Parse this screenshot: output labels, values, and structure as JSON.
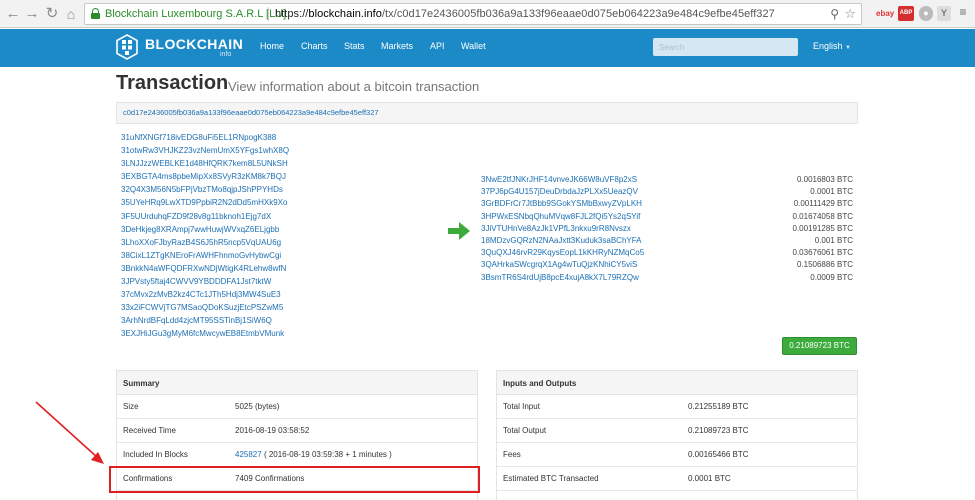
{
  "browser": {
    "site_identity": "Blockchain Luxembourg S.A.R.L [LU]",
    "url_prefix": "https://",
    "url_host": "blockchain.info",
    "url_path": "/tx/c0d17e2436005fb036a9a133f96eaae0d075eb064223a9e484c9efbe45eff327",
    "extensions": [
      "ebay",
      "ABP",
      "Y"
    ]
  },
  "navbar": {
    "logo_text": "BLOCKCHAIN",
    "logo_sub": "info",
    "items": [
      "Home",
      "Charts",
      "Stats",
      "Markets",
      "API",
      "Wallet"
    ],
    "search_placeholder": "Search",
    "language": "English"
  },
  "page": {
    "title": "Transaction",
    "subtitle": "View information about a bitcoin transaction",
    "tx_hash": "c0d17e2436005fb036a9a133f96eaae0d075eb064223a9e484c9efbe45eff327"
  },
  "inputs": [
    "31uNfXNGf718ivEDG8uFi5EL1RNpogK388",
    "31otwRw3VHJKZ23vzNemUmX5YFgs1whX8Q",
    "3LNJJzzWEBLKE1d48HfQRK7kem8L5UNkSH",
    "3EXBGTA4ms8pbeMipXx8SVyR3zKM8k7BQJ",
    "32Q4X3M56N5bFPjVbzTMo8qjpJShPPYHDs",
    "35UYeHRq9LwXTD9PpbiR2N2dDd5mHXk9Xo",
    "3F5UUrduhqFZD9f28v8g11bknoh1Ejg7dX",
    "3DeHkjeg8XRAmpj7wwHuwjWVxqZ6ELjgbb",
    "3LhoXXoFJbyRazB4S6J5hR5ncp5VqUAU6g",
    "38CixL1ZTgKNEroFrAWHFhnmoGvHybwCgi",
    "3BnkkN4aWFQDFRXwNDjWtigK4RLehw8wfN",
    "3JPVsty5ftaj4CWVV9YBDDDFA1Jst7tktW",
    "37cMvx2zMvB2kz4CTc1JTh5Hdj3MW4SuE3",
    "33x2iFCWVjTG7MSaoQDoKSuzjEtcPSZwM5",
    "3ArhNrdBFqLdd4zjcMT95SSTinBj1SiW6Q",
    "3EXJHiJGu3gMyM6fcMwcywEB8EtmbVMunk"
  ],
  "outputs": [
    {
      "address": "3NwE2tfJNKrJHF14vnveJK66W8uVF8p2xS",
      "amount": "0.0016803 BTC"
    },
    {
      "address": "37PJ6pG4U157jDeuDrbdaJzPLXx5UeazQV",
      "amount": "0.0001 BTC"
    },
    {
      "address": "3GrBDFrCr7JtBbb9SGokYSMbBxwyZVpLKH",
      "amount": "0.00111429 BTC"
    },
    {
      "address": "3HPWxESNbqQhuMVqw8FJL2fQi5Ys2qSYif",
      "amount": "0.01674058 BTC"
    },
    {
      "address": "3JiVTUHnVe8AzJk1VPfL3nkxu9rR8Nvszx",
      "amount": "0.00191285 BTC"
    },
    {
      "address": "18MDzvGQRzN2NAaJxtt3Kuduk3saBChYFA",
      "amount": "0.001 BTC"
    },
    {
      "address": "3QuQXJ46rvR29KqysEopL1kKHRyNZMqCo5",
      "amount": "0.03676061 BTC"
    },
    {
      "address": "3QAHrkaSWcgrqX1Ag4wTuQjzKNhiCY5viS",
      "amount": "0.1506886 BTC"
    },
    {
      "address": "3BsmTR6S4rdUjB8pcE4xujA8kX7L79RZQw",
      "amount": "0.0009 BTC"
    }
  ],
  "total_output_button": "0.21089723 BTC",
  "summary": {
    "title": "Summary",
    "rows": [
      {
        "key": "Size",
        "value": "5025 (bytes)"
      },
      {
        "key": "Received Time",
        "value": "2016-08-19 03:58:52"
      },
      {
        "key": "Included In Blocks",
        "block_link": "425827",
        "value": "( 2016-08-19 03:59:38 + 1 minutes )"
      },
      {
        "key": "Confirmations",
        "value": "7409 Confirmations"
      }
    ]
  },
  "io": {
    "title": "Inputs and Outputs",
    "rows": [
      {
        "key": "Total Input",
        "value": "0.21255189 BTC"
      },
      {
        "key": "Total Output",
        "value": "0.21089723 BTC"
      },
      {
        "key": "Fees",
        "value": "0.00165466 BTC"
      },
      {
        "key": "Estimated BTC Transacted",
        "value": "0.0001 BTC"
      }
    ]
  },
  "colors": {
    "navbar": "#1c8ac7",
    "link": "#1c6fb4",
    "total_button": "#3cab3c",
    "annotation": "#e02020"
  }
}
